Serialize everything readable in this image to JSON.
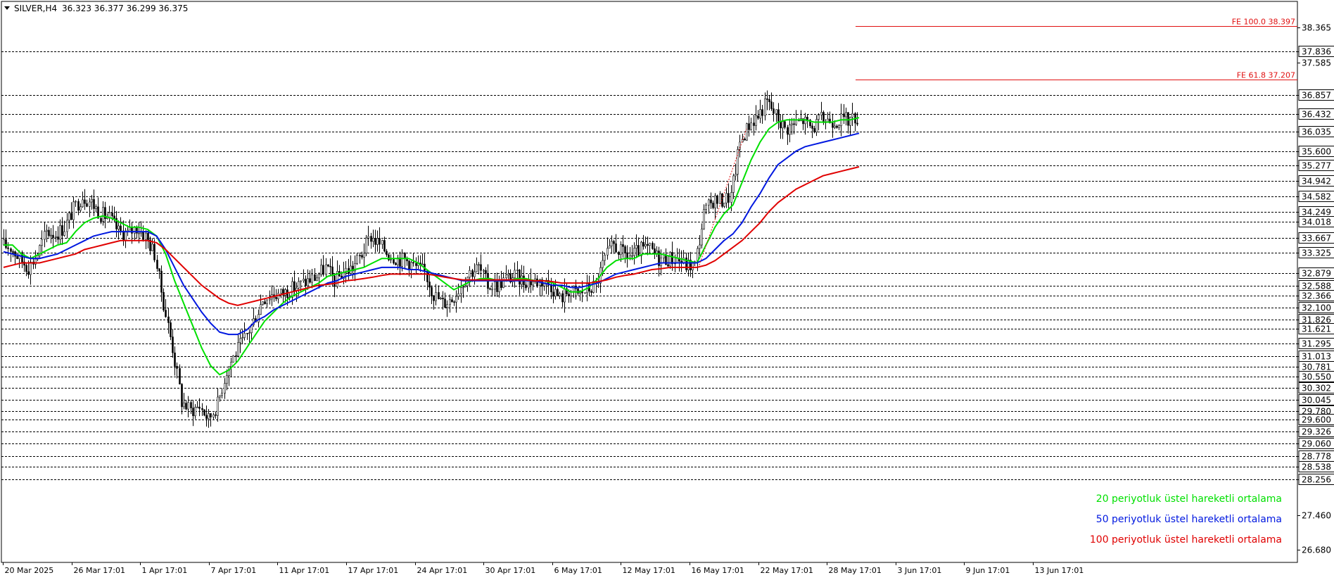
{
  "header": {
    "symbol": "SILVER,H4",
    "ohlc": "36.323 36.377 36.299 36.375"
  },
  "colors": {
    "ema20": "#00e000",
    "ema50": "#0018e0",
    "ema100": "#e00000",
    "fe": "#e01010",
    "candle": "#000000",
    "level": "#000000",
    "dashed_wave": "#e01010"
  },
  "chart_data": {
    "type": "line",
    "instrument": "SILVER",
    "timeframe": "H4",
    "ylim": [
      26.4,
      38.95
    ],
    "x_ticks": [
      "20 Mar 2025",
      "26 Mar 17:01",
      "1 Apr 17:01",
      "7 Apr 17:01",
      "11 Apr 17:01",
      "17 Apr 17:01",
      "24 Apr 17:01",
      "30 Apr 17:01",
      "6 May 17:01",
      "12 May 17:01",
      "16 May 17:01",
      "22 May 17:01",
      "28 May 17:01",
      "3 Jun 17:01",
      "9 Jun 17:01",
      "13 Jun 17:01"
    ],
    "y_axis_labels": [
      "38.365",
      "37.585",
      "27.460",
      "26.680"
    ],
    "levels": [
      "37.836",
      "36.857",
      "36.432",
      "36.035",
      "35.600",
      "35.277",
      "34.942",
      "34.582",
      "34.249",
      "34.018",
      "33.667",
      "33.325",
      "32.879",
      "32.588",
      "32.366",
      "32.100",
      "31.826",
      "31.621",
      "31.295",
      "31.013",
      "30.781",
      "30.550",
      "30.302",
      "30.045",
      "29.780",
      "29.600",
      "29.326",
      "29.060",
      "28.778",
      "28.538",
      "28.256"
    ],
    "fibonacci": [
      {
        "label": "FE 100.0 38.397",
        "value": 38.397
      },
      {
        "label": "FE 61.8 37.207",
        "value": 37.207
      }
    ],
    "legend": [
      {
        "label": "20 periyotluk üstel hareketli ortalama",
        "color": "#00e000"
      },
      {
        "label": "50 periyotluk üstel hareketli ortalama",
        "color": "#0018e0"
      },
      {
        "label": "100 periyotluk üstel hareketli ortalama",
        "color": "#e00000"
      }
    ],
    "x": [
      0,
      4,
      8,
      12,
      16,
      20,
      24,
      28,
      32,
      36,
      40,
      44,
      48,
      52,
      56,
      60,
      64,
      68,
      72,
      76,
      80,
      84,
      88,
      92,
      96,
      100,
      104,
      108,
      112,
      116,
      120,
      124,
      128,
      132,
      136,
      140,
      144,
      148,
      152,
      156,
      160,
      164,
      168,
      172,
      176,
      180,
      184,
      188,
      192,
      196,
      200,
      204,
      208,
      212,
      216,
      220,
      224,
      228,
      232,
      236,
      240,
      244,
      248,
      252,
      256,
      260,
      264,
      268,
      272,
      276,
      280,
      284,
      288,
      292,
      296,
      300,
      304,
      308,
      312,
      316,
      320,
      324,
      328,
      332,
      336,
      340,
      344,
      348,
      352,
      356,
      360,
      364,
      368,
      372,
      376,
      380
    ],
    "series": [
      {
        "name": "SILVER,H4",
        "values": [
          33.5,
          33.45,
          33.2,
          33.0,
          33.3,
          33.8,
          33.75,
          33.9,
          34.3,
          34.6,
          34.45,
          34.2,
          34.1,
          33.8,
          33.75,
          33.9,
          33.7,
          33.3,
          32.2,
          31.2,
          30.0,
          29.8,
          29.9,
          29.6,
          29.95,
          30.7,
          31.1,
          31.4,
          31.8,
          32.3,
          32.4,
          32.4,
          32.5,
          32.6,
          32.7,
          32.8,
          33.0,
          32.7,
          32.9,
          33.0,
          33.3,
          33.7,
          33.5,
          33.3,
          33.2,
          33.15,
          33.0,
          32.9,
          32.4,
          32.2,
          32.3,
          32.6,
          32.9,
          33.0,
          32.6,
          32.6,
          32.75,
          32.8,
          32.7,
          32.7,
          32.7,
          32.6,
          32.3,
          32.5,
          32.4,
          32.5,
          32.6,
          33.2,
          33.5,
          33.3,
          33.25,
          33.4,
          33.4,
          33.2,
          33.2,
          33.2,
          33.05,
          33.05,
          34.2,
          34.5,
          34.5,
          34.6,
          35.8,
          36.2,
          36.4,
          36.7,
          36.4,
          36.1,
          36.2,
          36.3,
          36.1,
          36.3,
          36.3,
          36.3,
          36.3,
          36.375
        ]
      },
      {
        "name": "",
        "values": [
          33.5,
          33.5,
          33.3,
          33.2,
          33.3,
          33.4,
          33.5,
          33.55,
          33.8,
          34.0,
          34.1,
          34.15,
          34.1,
          34.0,
          33.9,
          33.9,
          33.85,
          33.7,
          33.3,
          32.7,
          32.2,
          31.7,
          31.2,
          30.8,
          30.6,
          30.7,
          30.9,
          31.2,
          31.5,
          31.8,
          32.0,
          32.2,
          32.35,
          32.45,
          32.55,
          32.65,
          32.8,
          32.85,
          32.9,
          32.95,
          33.0,
          33.1,
          33.2,
          33.2,
          33.2,
          33.2,
          33.1,
          32.95,
          32.8,
          32.65,
          32.5,
          32.6,
          32.7,
          32.75,
          32.75,
          32.7,
          32.7,
          32.75,
          32.75,
          32.7,
          32.7,
          32.65,
          32.55,
          32.45,
          32.45,
          32.55,
          32.75,
          33.0,
          33.15,
          33.2,
          33.2,
          33.3,
          33.3,
          33.3,
          33.25,
          33.2,
          33.15,
          33.1,
          33.5,
          33.9,
          34.2,
          34.4,
          34.9,
          35.4,
          35.8,
          36.1,
          36.25,
          36.3,
          36.3,
          36.3,
          36.25,
          36.25,
          36.25,
          36.3,
          36.3,
          36.35
        ]
      },
      {
        "name": "",
        "values": [
          33.35,
          33.3,
          33.25,
          33.2,
          33.2,
          33.25,
          33.3,
          33.4,
          33.5,
          33.6,
          33.7,
          33.75,
          33.8,
          33.8,
          33.8,
          33.8,
          33.8,
          33.7,
          33.4,
          33.0,
          32.6,
          32.3,
          32.0,
          31.75,
          31.55,
          31.5,
          31.5,
          31.6,
          31.8,
          31.9,
          32.05,
          32.15,
          32.25,
          32.35,
          32.45,
          32.55,
          32.65,
          32.7,
          32.8,
          32.85,
          32.9,
          32.95,
          33.0,
          33.0,
          33.0,
          32.95,
          32.95,
          32.9,
          32.85,
          32.8,
          32.75,
          32.7,
          32.7,
          32.7,
          32.7,
          32.7,
          32.7,
          32.7,
          32.7,
          32.7,
          32.65,
          32.6,
          32.6,
          32.55,
          32.55,
          32.6,
          32.65,
          32.75,
          32.85,
          32.9,
          32.95,
          33.0,
          33.05,
          33.1,
          33.1,
          33.1,
          33.1,
          33.1,
          33.2,
          33.4,
          33.6,
          33.75,
          34.0,
          34.35,
          34.65,
          35.0,
          35.3,
          35.45,
          35.6,
          35.7,
          35.75,
          35.8,
          35.85,
          35.9,
          35.95,
          36.0
        ]
      },
      {
        "name": "",
        "values": [
          33.0,
          33.05,
          33.1,
          33.1,
          33.1,
          33.15,
          33.2,
          33.25,
          33.3,
          33.4,
          33.45,
          33.5,
          33.55,
          33.6,
          33.6,
          33.6,
          33.6,
          33.55,
          33.4,
          33.2,
          33.0,
          32.8,
          32.6,
          32.45,
          32.3,
          32.2,
          32.15,
          32.2,
          32.25,
          32.3,
          32.35,
          32.4,
          32.45,
          32.5,
          32.55,
          32.6,
          32.62,
          32.65,
          32.7,
          32.72,
          32.75,
          32.78,
          32.82,
          32.85,
          32.85,
          32.85,
          32.85,
          32.85,
          32.82,
          32.78,
          32.75,
          32.72,
          32.72,
          32.72,
          32.72,
          32.72,
          32.72,
          32.72,
          32.72,
          32.7,
          32.7,
          32.68,
          32.65,
          32.65,
          32.65,
          32.65,
          32.68,
          32.72,
          32.78,
          32.82,
          32.85,
          32.9,
          32.95,
          32.97,
          33.0,
          33.0,
          33.0,
          33.0,
          33.05,
          33.15,
          33.3,
          33.45,
          33.6,
          33.8,
          34.0,
          34.25,
          34.45,
          34.6,
          34.75,
          34.85,
          34.95,
          35.05,
          35.1,
          35.15,
          35.2,
          35.25
        ]
      }
    ]
  }
}
